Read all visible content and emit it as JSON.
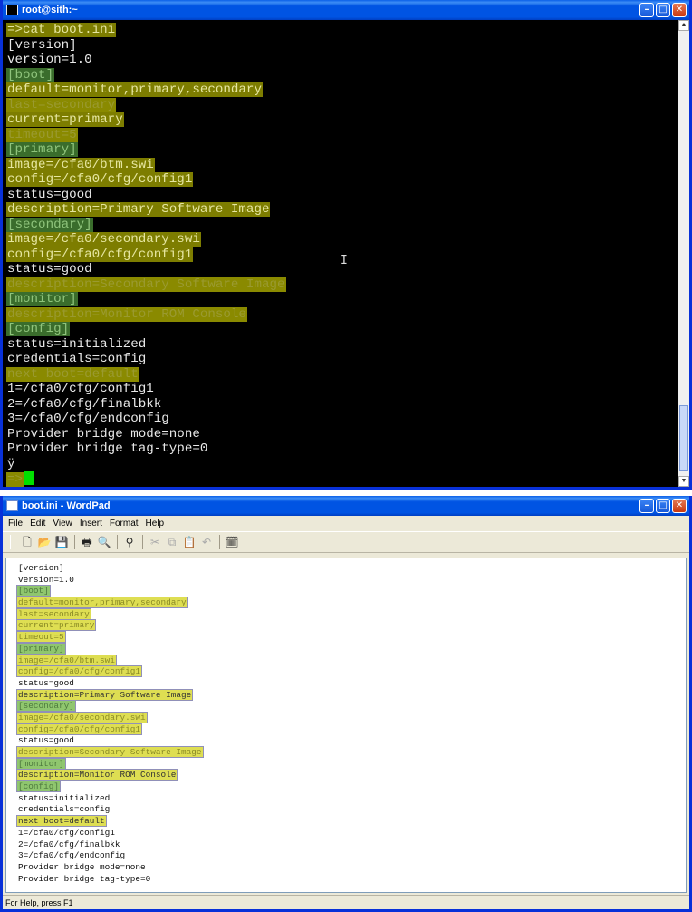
{
  "terminal": {
    "title": "root@sith:~",
    "lines": [
      {
        "text": "=>cat boot.ini",
        "hl": "hy"
      },
      {
        "text": "[version]",
        "hl": ""
      },
      {
        "text": "version=1.0",
        "hl": ""
      },
      {
        "text": "[boot]",
        "hl": "hg"
      },
      {
        "text": "default=monitor,primary,secondary",
        "hl": "hy"
      },
      {
        "text": "last=secondary",
        "hl": "hy2"
      },
      {
        "text": "current=primary",
        "hl": "hy"
      },
      {
        "text": "timeout=5",
        "hl": "hy2"
      },
      {
        "text": "[primary]",
        "hl": "hg"
      },
      {
        "text": "image=/cfa0/btm.swi",
        "hl": "hy"
      },
      {
        "text": "config=/cfa0/cfg/config1",
        "hl": "hy"
      },
      {
        "text": "status=good",
        "hl": ""
      },
      {
        "text": "description=Primary Software Image",
        "hl": "hy"
      },
      {
        "text": "[secondary]",
        "hl": "hg"
      },
      {
        "text": "image=/cfa0/secondary.swi",
        "hl": "hy"
      },
      {
        "text": "config=/cfa0/cfg/config1",
        "hl": "hy"
      },
      {
        "text": "status=good",
        "hl": ""
      },
      {
        "text": "description=Secondary Software Image",
        "hl": "hy2"
      },
      {
        "text": "[monitor]",
        "hl": "hg"
      },
      {
        "text": "description=Monitor ROM Console",
        "hl": "hy2"
      },
      {
        "text": "[config]",
        "hl": "hg"
      },
      {
        "text": "status=initialized",
        "hl": ""
      },
      {
        "text": "credentials=config",
        "hl": ""
      },
      {
        "text": "next boot=default",
        "hl": "hy2"
      },
      {
        "text": "1=/cfa0/cfg/config1",
        "hl": ""
      },
      {
        "text": "2=/cfa0/cfg/finalbkk",
        "hl": ""
      },
      {
        "text": "3=/cfa0/cfg/endconfig",
        "hl": ""
      },
      {
        "text": "Provider bridge mode=none",
        "hl": ""
      },
      {
        "text": "Provider bridge tag-type=0",
        "hl": ""
      },
      {
        "text": "ÿ",
        "hl": ""
      }
    ],
    "prompt": "=>"
  },
  "wordpad": {
    "title": "boot.ini - WordPad",
    "menu": [
      "File",
      "Edit",
      "View",
      "Insert",
      "Format",
      "Help"
    ],
    "toolbar_icons": [
      "new-icon",
      "open-icon",
      "save-icon",
      "print-icon",
      "print-preview-icon",
      "find-icon",
      "cut-icon",
      "copy-icon",
      "paste-icon",
      "undo-icon",
      "date-time-icon"
    ],
    "lines": [
      {
        "text": "[version]",
        "hl": ""
      },
      {
        "text": "version=1.0",
        "hl": ""
      },
      {
        "text": "[boot]",
        "hl": "hg"
      },
      {
        "text": "default=monitor,primary,secondary",
        "hl": "hy"
      },
      {
        "text": "last=secondary",
        "hl": "hy"
      },
      {
        "text": "current=primary",
        "hl": "hy"
      },
      {
        "text": "timeout=5",
        "hl": "hy"
      },
      {
        "text": "[primary]",
        "hl": "hg"
      },
      {
        "text": "image=/cfa0/btm.swi",
        "hl": "hy"
      },
      {
        "text": "config=/cfa0/cfg/config1",
        "hl": "hy"
      },
      {
        "text": "status=good",
        "hl": ""
      },
      {
        "text": "description=Primary Software Image",
        "hl": "hy dark"
      },
      {
        "text": "[secondary]",
        "hl": "hg"
      },
      {
        "text": "image=/cfa0/secondary.swi",
        "hl": "hy"
      },
      {
        "text": "config=/cfa0/cfg/config1",
        "hl": "hy"
      },
      {
        "text": "status=good",
        "hl": ""
      },
      {
        "text": "description=Secondary Software Image",
        "hl": "hy"
      },
      {
        "text": "[monitor]",
        "hl": "hg"
      },
      {
        "text": "description=Monitor ROM Console",
        "hl": "hy dark"
      },
      {
        "text": "[config]",
        "hl": "hg"
      },
      {
        "text": "status=initialized",
        "hl": ""
      },
      {
        "text": "credentials=config",
        "hl": ""
      },
      {
        "text": "next boot=default",
        "hl": "hy dark"
      },
      {
        "text": "1=/cfa0/cfg/config1",
        "hl": ""
      },
      {
        "text": "2=/cfa0/cfg/finalbkk",
        "hl": ""
      },
      {
        "text": "3=/cfa0/cfg/endconfig",
        "hl": ""
      },
      {
        "text": "Provider bridge mode=none",
        "hl": ""
      },
      {
        "text": "Provider bridge tag-type=0",
        "hl": ""
      }
    ],
    "status": "For Help, press F1"
  },
  "window_buttons": {
    "minimize": "–",
    "maximize": "□",
    "close": "✕"
  }
}
